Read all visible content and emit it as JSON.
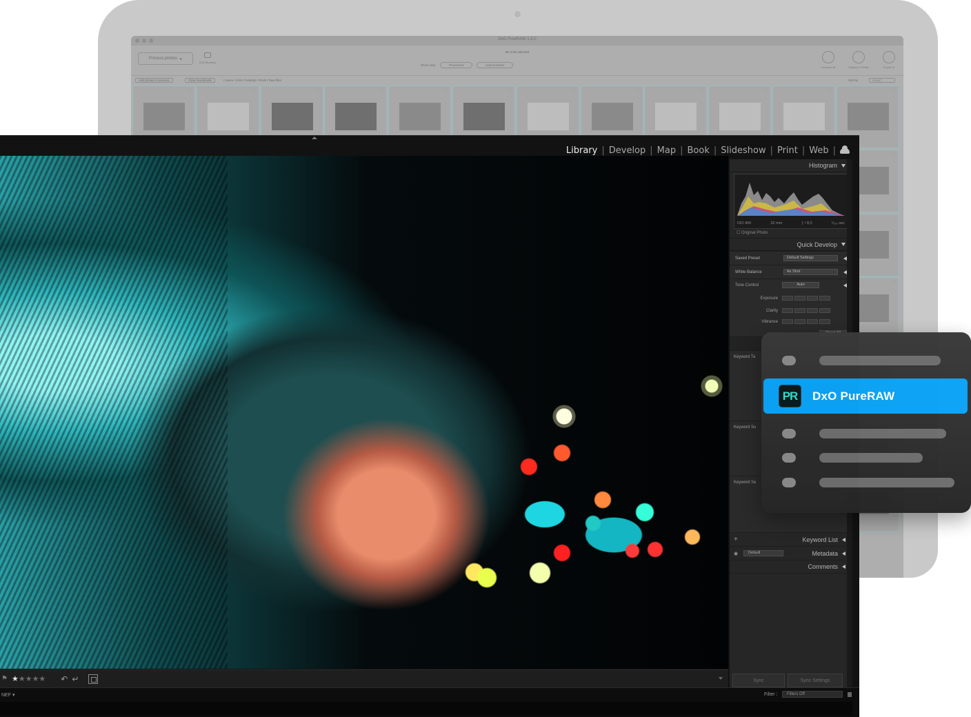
{
  "pureraw": {
    "window_title": "DxO PureRAW 1.5.0",
    "process_button": "Process photos",
    "dxomark_label": "DxO Modules",
    "selected_count": "85 of 85 selected",
    "show_only_label": "Show only:",
    "filter_processed": "Processed",
    "filter_unprocessed": "Unprocessed",
    "actions": [
      "Uncheck all",
      "Display in Finder",
      "Export to"
    ],
    "add_photos": "Add photos to process",
    "clear_thumbnails": "Clear thumbnails",
    "path": "/ Users / chris / Desktop / RAW / Raw files",
    "sort_label": "Sort by",
    "sort_value": "A to Z"
  },
  "lightroom": {
    "modules": [
      "Library",
      "Develop",
      "Map",
      "Book",
      "Slideshow",
      "Print",
      "Web"
    ],
    "active_module": "Library",
    "histogram": {
      "title": "Histogram",
      "iso": "ISO 400",
      "focal": "32 mm",
      "aperture": "ƒ / 8,0",
      "shutter": "¹⁄₁₆₀ sec",
      "original_photo": "Original Photo"
    },
    "quick_develop": {
      "title": "Quick Develop",
      "saved_preset_label": "Saved Preset",
      "saved_preset_value": "Default Settings",
      "white_balance_label": "White Balance",
      "white_balance_value": "As Shot",
      "tone_control_label": "Tone Control",
      "tone_control_value": "Auto",
      "exposure": "Exposure",
      "clarity": "Clarity",
      "vibrance": "Vibrance",
      "reset_all": "Reset All"
    },
    "keywording": {
      "tags": "Keyword Ta",
      "suggestions": "Keyword Su",
      "set": "Keyword Se"
    },
    "keyword_list": "Keyword List",
    "metadata_preset": "Default",
    "metadata": "Metadata",
    "comments": "Comments",
    "sync": "Sync",
    "sync_settings": "Sync Settings",
    "toolbar_stars": "★★★★★",
    "rating": 1,
    "filmstrip_source": "NEF ▾",
    "filter_label": "Filter :",
    "filter_value": "Filters Off"
  },
  "plugin_menu": {
    "highlight_label": "DxO PureRAW",
    "logo_text": "PR"
  }
}
